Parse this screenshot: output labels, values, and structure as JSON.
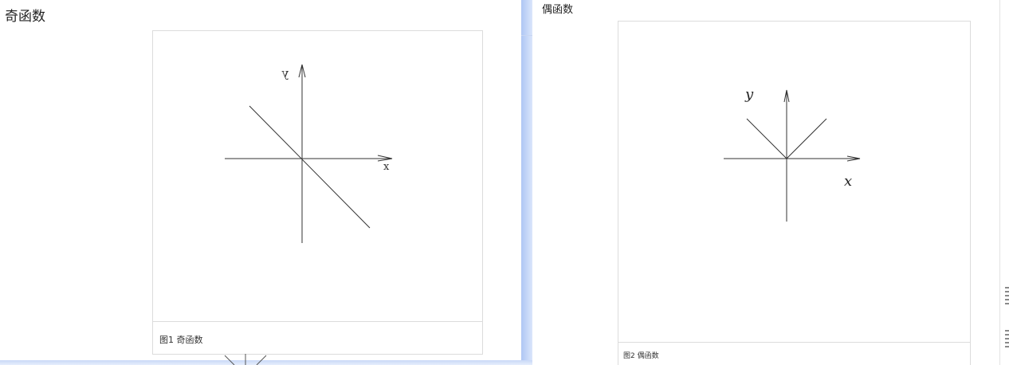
{
  "left": {
    "title": "奇函数",
    "figure": {
      "caption": "图1 奇函数",
      "y_label": "y",
      "x_label": "x"
    }
  },
  "right": {
    "title": "偶函数",
    "figure": {
      "caption": "图2 偶函数",
      "y_label": "y",
      "x_label": "x"
    }
  },
  "colors": {
    "panel_shadow": "#aec6f4",
    "border": "#dcdcdc",
    "ink": "#333333"
  }
}
